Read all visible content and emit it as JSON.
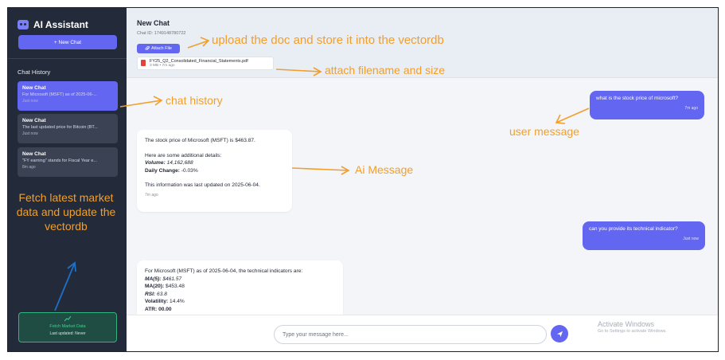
{
  "sidebar": {
    "app_title": "AI Assistant",
    "new_chat_label": "+ New Chat",
    "history_title": "Chat History",
    "items": [
      {
        "title": "New Chat",
        "preview": "For Microsoft (MSFT) as of 2025-06-...",
        "meta": "Just now"
      },
      {
        "title": "New Chat",
        "preview": "The last updated price for Bitcoin (BT...",
        "meta": "Just now"
      },
      {
        "title": "New Chat",
        "preview": "\"FY earning\" stands for Fiscal Year e...",
        "meta": "8m ago"
      }
    ],
    "fetch_button_label": "Fetch Market Data",
    "fetch_last_updated": "Last updated: Never"
  },
  "header": {
    "title": "New Chat",
    "chat_id": "Chat ID: 1749148780722",
    "attach_label": "Attach File",
    "file_name": "FY25_Q2_Consolidated_Financial_Statements.pdf",
    "file_meta": "3 MB • 7m ago"
  },
  "messages": {
    "user1": {
      "text": "what is the stock price of microsoft?",
      "time": "7m ago"
    },
    "ai1": {
      "line1": "The stock price of Microsoft (MSFT) is $463.87.",
      "line2": "Here are some additional details:",
      "volume_label": "Volume:",
      "volume_value": "14,162,688",
      "change_label": "Daily Change:",
      "change_value": "-0.03%",
      "line3": "This information was last updated on 2025-06-04.",
      "time": "7m ago"
    },
    "user2": {
      "text": "can you provide its technical indicator?",
      "time": "Just now"
    },
    "ai2": {
      "line1": "For Microsoft (MSFT) as of 2025-06-04, the technical indicators are:",
      "ma5_label": "MA(5):",
      "ma5_value": "$461.57",
      "ma20_label": "MA(20):",
      "ma20_value": "$453.48",
      "rsi_label": "RSI:",
      "rsi_value": "63.8",
      "vol_label": "Volatility:",
      "vol_value": "14.4%",
      "atr_partial": "ATR: 00.00"
    }
  },
  "input": {
    "placeholder": "Type your message here..."
  },
  "watermark": {
    "line1": "Activate Windows",
    "line2": "Go to Settings to activate Windows."
  },
  "annotations": {
    "upload": "upload the doc and store it into the vectordb",
    "attach": "attach filename and size",
    "history": "chat history",
    "user_message": "user message",
    "ai_message": "Ai Message",
    "fetch": "Fetch latest market data and update the vectordb"
  },
  "colors": {
    "accent": "#6366f1",
    "sidebar_bg": "#232b3b",
    "annotation": "#f29f2a",
    "fetch_green": "#3fd08f"
  }
}
